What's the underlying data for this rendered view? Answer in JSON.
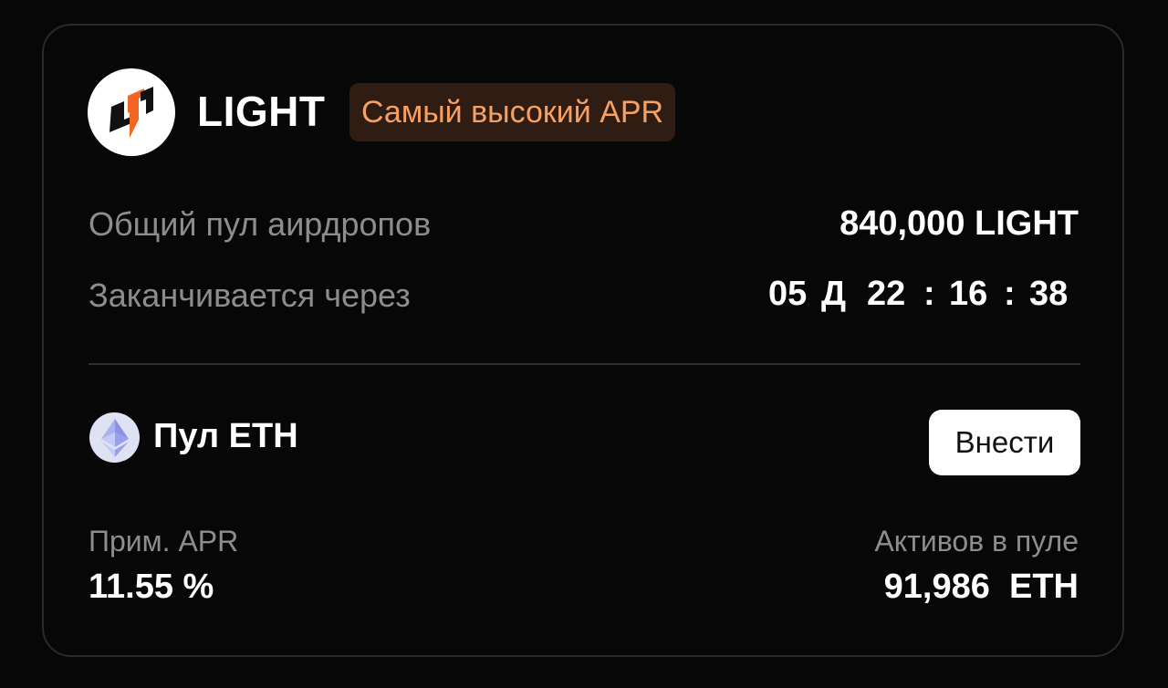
{
  "token": {
    "name": "LIGHT",
    "badge": "Самый высокий APR",
    "logo_icon": "light-lightning-logo",
    "accent_color": "#f26522"
  },
  "airdrop": {
    "pool_label": "Общий пул аирдропов",
    "pool_value": "840,000 LIGHT",
    "ends_label": "Заканчивается через",
    "countdown": {
      "days": "05",
      "days_unit": "Д",
      "hours": "22",
      "sep1": ":",
      "minutes": "16",
      "sep2": ":",
      "seconds": "38"
    }
  },
  "pool": {
    "icon": "ethereum-icon",
    "title": "Пул ETH",
    "deposit_label": "Внести",
    "apr_label": "Прим. APR",
    "apr_value": "11.55 %",
    "assets_label": "Активов в пуле",
    "assets_value": "91,986  ETH"
  }
}
